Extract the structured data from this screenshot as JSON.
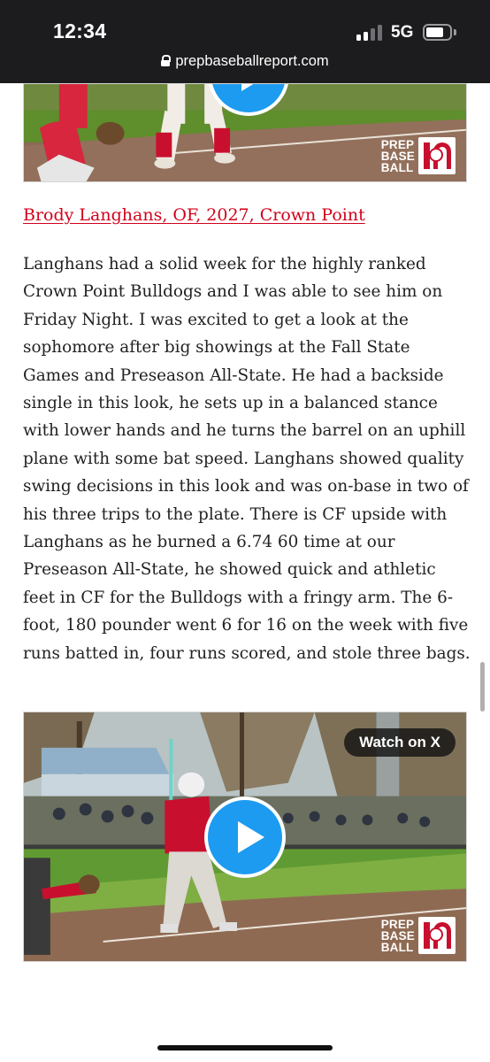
{
  "status_bar": {
    "time": "12:34",
    "network": "5G"
  },
  "browser": {
    "url": "prepbaseballreport.com"
  },
  "video_top": {
    "logo_lines": [
      "PREP",
      "BASE",
      "BALL"
    ],
    "play_icon": "play-icon"
  },
  "article": {
    "player_link": "Brody Langhans, OF, 2027, Crown Point",
    "body": "Langhans had a solid week for the highly ranked Crown Point Bulldogs and I was able to see him on Friday Night. I was excited to get a look at the sophomore after big showings at the Fall State Games and Preseason All-State. He had a backside single in this look, he sets up in a balanced stance with lower hands and he turns the barrel on an uphill plane with some bat speed. Langhans showed quality swing decisions in this look and was on-base in two of his three trips to the plate. There is CF upside with Langhans as he burned a 6.74 60 time at our Preseason All-State, he showed quick and athletic feet in CF for the Bulldogs with a fringy arm. The 6-foot, 180 pounder went 6 for 16 on the week with five runs batted in, four runs scored, and stole three bags."
  },
  "video_embed": {
    "watch_label": "Watch on X",
    "logo_lines": [
      "PREP",
      "BASE",
      "BALL"
    ],
    "play_icon": "play-icon"
  },
  "colors": {
    "link_red": "#d0021b",
    "play_blue": "#1d9bf0",
    "chrome_bg": "#1c1c1e"
  }
}
